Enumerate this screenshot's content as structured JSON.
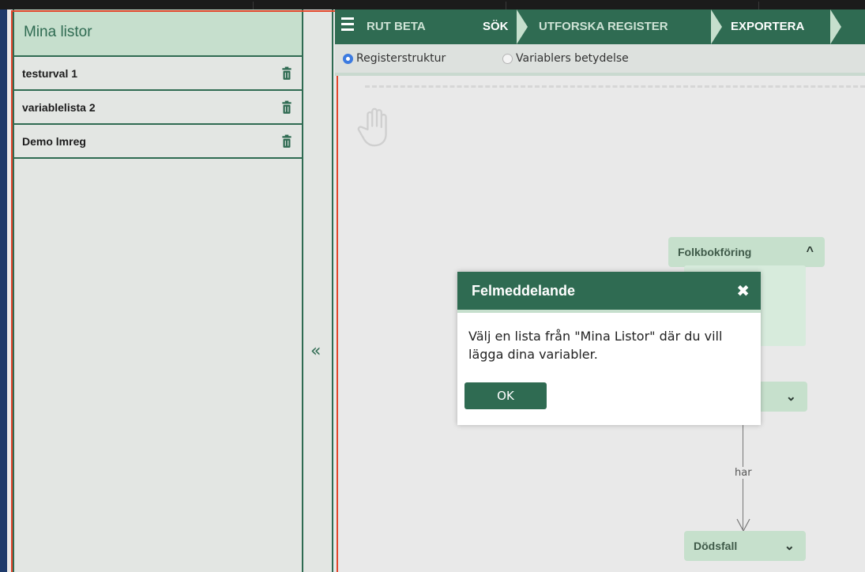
{
  "sidebar": {
    "title": "Mina listor",
    "items": [
      {
        "label": "testurval 1",
        "icon": "trash-icon"
      },
      {
        "label": "variablelista 2",
        "icon": "trash-icon"
      },
      {
        "label": "Demo lmreg",
        "icon": "trash-icon"
      }
    ],
    "collapse_glyph": "«"
  },
  "nav": {
    "items": [
      "RUT BETA",
      "SÖK",
      "UTFORSKA REGISTER",
      "EXPORTERA"
    ],
    "menu_icon": "hamburger-icon"
  },
  "view_options": {
    "selected": "Registerstruktur",
    "options": [
      "Registerstruktur",
      "Variablers betydelse"
    ]
  },
  "diagram": {
    "nodes": [
      {
        "label": "Folkbokföring",
        "chevron": "^"
      },
      {
        "label": "",
        "chevron": "⌄"
      },
      {
        "label": "Dödsfall",
        "chevron": "⌄"
      }
    ],
    "edge_label": "har"
  },
  "dialog": {
    "title": "Felmeddelande",
    "close_glyph": "✖",
    "message": "Välj en lista från \"Mina Listor\" där du vill lägga dina variabler.",
    "ok_label": "OK"
  },
  "colors": {
    "brand_green": "#2f6b52",
    "light_green": "#c6dfcd",
    "highlight_frame": "#e3462b",
    "radio_selected": "#3c7be0"
  }
}
